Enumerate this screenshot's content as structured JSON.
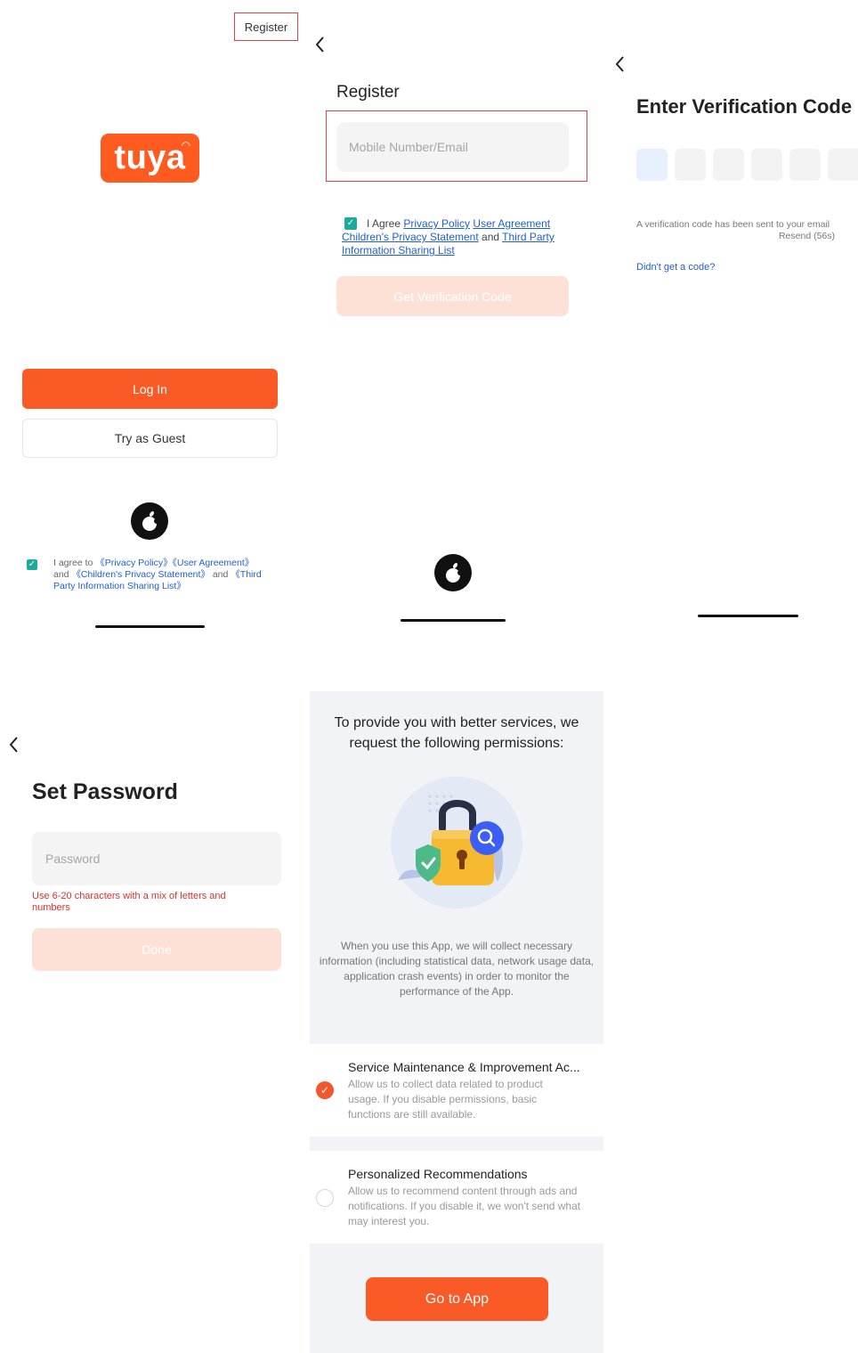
{
  "screen1": {
    "register_label": "Register",
    "logo_text": "tuya",
    "login_label": "Log In",
    "guest_label": "Try as Guest",
    "apple_icon": "apple-icon",
    "agree": {
      "prefix": "I agree to ",
      "privacy_policy": "《Privacy Policy》",
      "user_agreement": "《User Agreement》",
      "and1": "and ",
      "children_privacy": "《Children's Privacy Statement》",
      "and2": " and ",
      "third_party": "《Third Party Information Sharing List》"
    }
  },
  "screen2": {
    "title": "Register",
    "mobile_placeholder": "Mobile Number/Email",
    "agree": {
      "prefix": "I Agree ",
      "privacy_policy": "Privacy Policy",
      "user_agreement": "User Agreement",
      "children_privacy": "Children's Privacy Statement",
      "and": " and ",
      "third_party": "Third Party Information Sharing List"
    },
    "verify_label": "Get Verification Code"
  },
  "screen3": {
    "title": "Enter Verification Code",
    "sent_text": "A verification code has been sent to your email",
    "resend_text": "Resend (56s)",
    "didnt_get": "Didn't get a code?"
  },
  "screen4": {
    "title": "Set Password",
    "password_placeholder": "Password",
    "hint": "Use 6-20 characters with a mix of letters and numbers",
    "done_label": "Done"
  },
  "screen5": {
    "title": "To provide you with better services, we request the following permissions:",
    "description": "When you use this App, we will collect necessary information (including statistical data, network usage data, application crash events) in order to monitor the performance of the App.",
    "option1": {
      "title": "Service Maintenance & Improvement Ac...",
      "desc": "Allow us to collect data related to product usage. If you disable permissions, basic functions are still available.",
      "checked": true
    },
    "option2": {
      "title": "Personalized Recommendations",
      "desc": "Allow us to recommend content through ads and notifications. If you disable it, we won't send what may interest you.",
      "checked": false
    },
    "go_label": "Go to App"
  },
  "colors": {
    "accent": "#fa5a26",
    "accent_disabled": "#fde0d6",
    "link": "#1f5fd1",
    "check": "#1aab9b",
    "highlight_box": "#d9434a"
  }
}
